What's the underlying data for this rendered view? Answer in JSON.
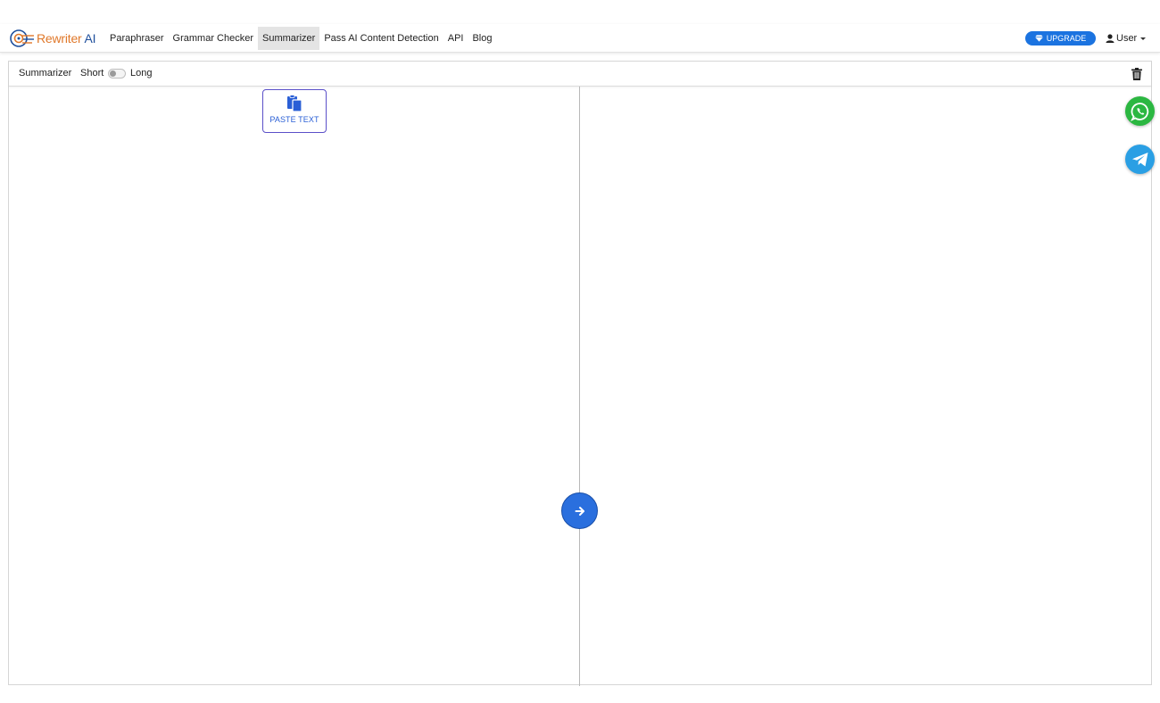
{
  "navbar": {
    "brand": {
      "part1": "Rewriter",
      "part2": "AI"
    },
    "links": [
      {
        "label": "Paraphraser",
        "active": false
      },
      {
        "label": "Grammar Checker",
        "active": false
      },
      {
        "label": "Summarizer",
        "active": true
      },
      {
        "label": "Pass AI Content Detection",
        "active": false
      },
      {
        "label": "API",
        "active": false
      },
      {
        "label": "Blog",
        "active": false
      }
    ],
    "upgrade_label": "UPGRADE",
    "user_label": "User"
  },
  "toolbar": {
    "title": "Summarizer",
    "mode_short": "Short",
    "mode_long": "Long",
    "toggle_on": false
  },
  "editor": {
    "paste_label": "PASTE TEXT"
  },
  "colors": {
    "accent": "#1b73e0",
    "action_button": "#2a6fde",
    "whatsapp": "#2bb741",
    "telegram": "#2a9fe4",
    "brand_orange": "#e0782a",
    "brand_blue": "#1f4f9c"
  },
  "icons": {
    "logo": "rewriter-ai-logo",
    "upgrade": "gem-icon",
    "user": "user-icon",
    "trash": "trash-icon",
    "paste": "clipboard-icon",
    "go": "arrow-right-icon",
    "whatsapp": "whatsapp-icon",
    "telegram": "telegram-icon"
  }
}
